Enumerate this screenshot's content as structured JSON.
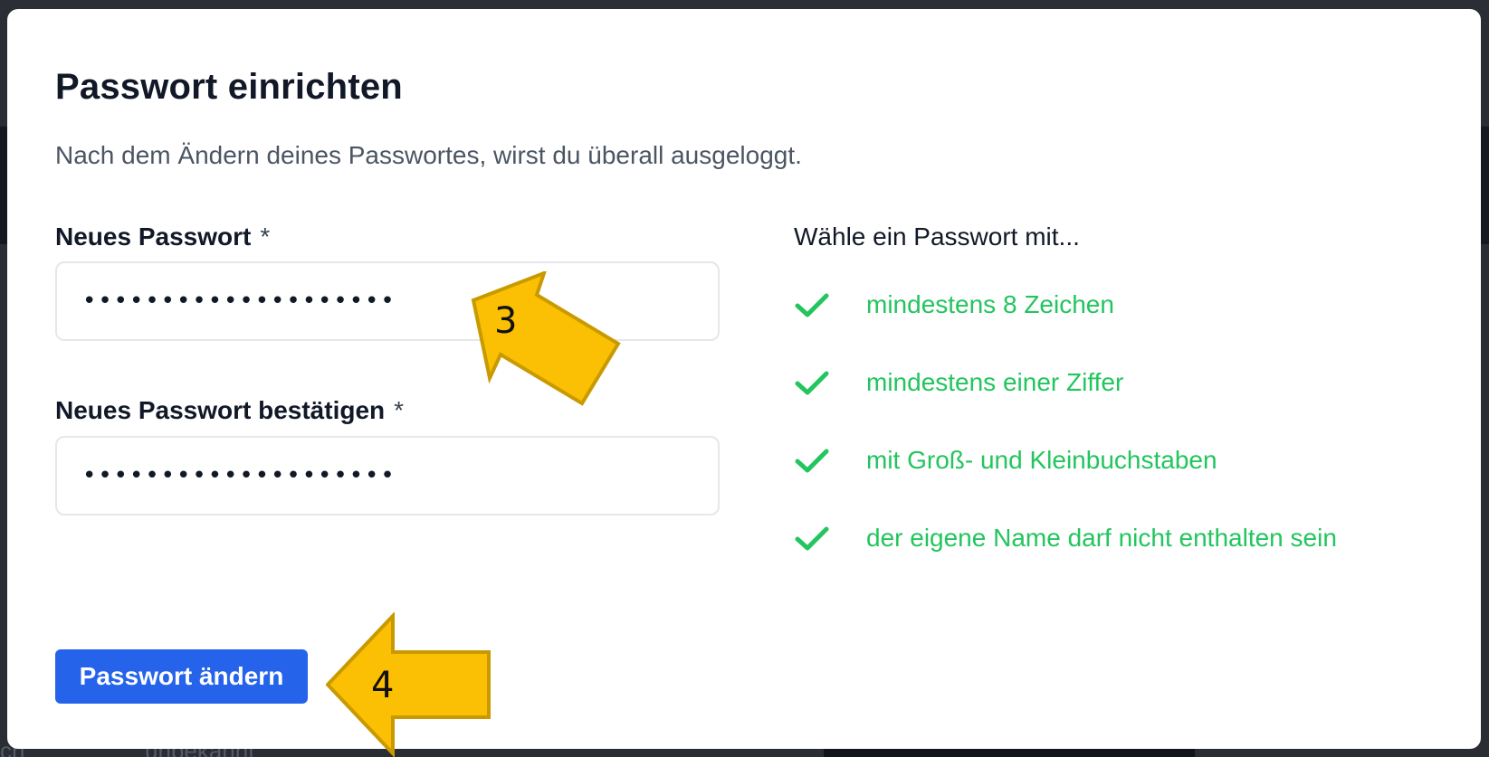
{
  "dialog": {
    "title": "Passwort einrichten",
    "subtitle": "Nach dem Ändern deines Passwortes, wirst du überall ausgeloggt."
  },
  "form": {
    "new_password": {
      "label": "Neues Passwort",
      "required_marker": "*",
      "value": "••••••••••••••••••••"
    },
    "confirm_password": {
      "label": "Neues Passwort bestätigen",
      "required_marker": "*",
      "value": "••••••••••••••••••••"
    }
  },
  "requirements": {
    "heading": "Wähle ein Passwort mit...",
    "items": [
      {
        "label": "mindestens 8 Zeichen",
        "icon": "check-icon",
        "status": "met"
      },
      {
        "label": "mindestens einer Ziffer",
        "icon": "check-icon",
        "status": "met"
      },
      {
        "label": "mit Groß- und Kleinbuchstaben",
        "icon": "check-icon",
        "status": "met"
      },
      {
        "label": "der eigene Name darf nicht enthalten sein",
        "icon": "check-icon",
        "status": "met"
      }
    ]
  },
  "actions": {
    "submit_label": "Passwort ändern"
  },
  "annotations": {
    "step_3": "3",
    "step_4": "4"
  },
  "background": {
    "partial_text": "unbekannt",
    "partial_text_left": "ch"
  },
  "colors": {
    "primary": "#2563eb",
    "success": "#22c55e",
    "text": "#111827",
    "muted": "#4b5563",
    "annotation_fill": "#fbbf04",
    "annotation_stroke": "#c99a00"
  }
}
